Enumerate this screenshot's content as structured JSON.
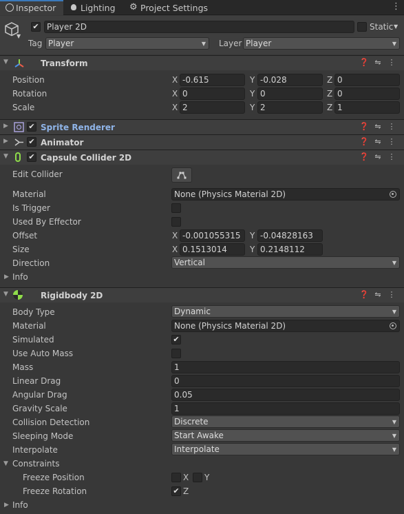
{
  "tabs": [
    {
      "label": "Inspector",
      "icon": "info-icon"
    },
    {
      "label": "Lighting",
      "icon": "bulb-icon"
    },
    {
      "label": "Project Settings",
      "icon": "gear-icon"
    }
  ],
  "gameobject": {
    "name": "Player 2D",
    "static_label": "Static",
    "tag_label": "Tag",
    "tag_value": "Player",
    "layer_label": "Layer",
    "layer_value": "Player"
  },
  "transform": {
    "title": "Transform",
    "position_label": "Position",
    "rotation_label": "Rotation",
    "scale_label": "Scale",
    "position": {
      "x": "-0.615",
      "y": "-0.028",
      "z": "0"
    },
    "rotation": {
      "x": "0",
      "y": "0",
      "z": "0"
    },
    "scale": {
      "x": "2",
      "y": "2",
      "z": "1"
    }
  },
  "axes": {
    "x": "X",
    "y": "Y",
    "z": "Z"
  },
  "sprite_renderer": {
    "title": "Sprite Renderer"
  },
  "animator": {
    "title": "Animator"
  },
  "capsule": {
    "title": "Capsule Collider 2D",
    "edit_collider_label": "Edit Collider",
    "material_label": "Material",
    "material_value": "None (Physics Material 2D)",
    "is_trigger_label": "Is Trigger",
    "used_by_effector_label": "Used By Effector",
    "offset_label": "Offset",
    "offset": {
      "x": "-0.001055315",
      "y": "-0.04828163"
    },
    "size_label": "Size",
    "size": {
      "x": "0.1513014",
      "y": "0.2148112"
    },
    "direction_label": "Direction",
    "direction_value": "Vertical",
    "info_label": "Info"
  },
  "rigidbody": {
    "title": "Rigidbody 2D",
    "body_type_label": "Body Type",
    "body_type_value": "Dynamic",
    "material_label": "Material",
    "material_value": "None (Physics Material 2D)",
    "simulated_label": "Simulated",
    "use_auto_mass_label": "Use Auto Mass",
    "mass_label": "Mass",
    "mass": "1",
    "linear_drag_label": "Linear Drag",
    "linear_drag": "0",
    "angular_drag_label": "Angular Drag",
    "angular_drag": "0.05",
    "gravity_scale_label": "Gravity Scale",
    "gravity_scale": "1",
    "collision_detection_label": "Collision Detection",
    "collision_detection_value": "Discrete",
    "sleeping_mode_label": "Sleeping Mode",
    "sleeping_mode_value": "Start Awake",
    "interpolate_label": "Interpolate",
    "interpolate_value": "Interpolate",
    "constraints_label": "Constraints",
    "freeze_position_label": "Freeze Position",
    "freeze_rotation_label": "Freeze Rotation",
    "info_label": "Info"
  },
  "colors": {
    "accent": "#3a79bb",
    "sprite_title": "#8fb4e8",
    "collider_green": "#8fdc4a"
  }
}
